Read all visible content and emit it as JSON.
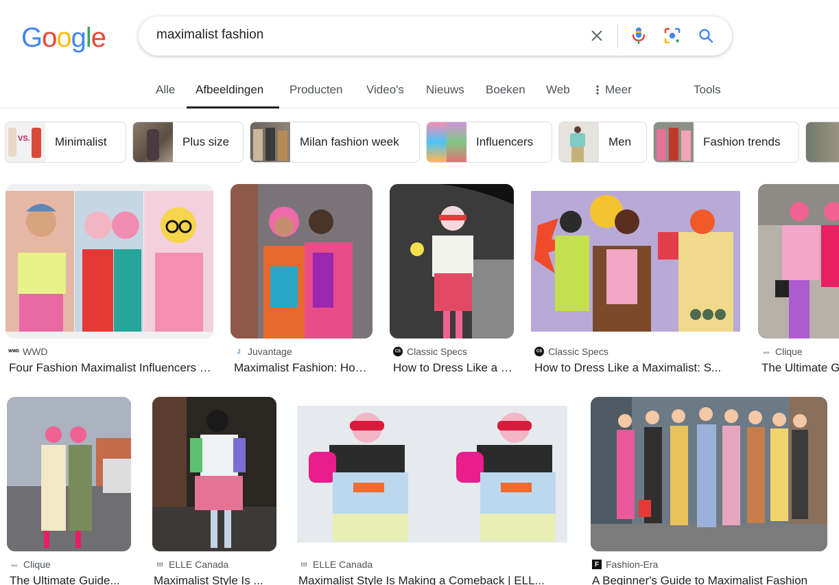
{
  "logo": {
    "letters": [
      "G",
      "o",
      "o",
      "g",
      "l",
      "e"
    ],
    "colors": [
      "#4285F4",
      "#EA4335",
      "#FBBC05",
      "#4285F4",
      "#34A853",
      "#EA4335"
    ]
  },
  "search": {
    "query": "maximalist fashion",
    "icons": [
      "close-icon",
      "microphone-icon",
      "lens-icon",
      "search-icon"
    ]
  },
  "tabs": {
    "items": [
      {
        "label": "Alle"
      },
      {
        "label": "Afbeeldingen"
      },
      {
        "label": "Producten"
      },
      {
        "label": "Video's"
      },
      {
        "label": "Nieuws"
      },
      {
        "label": "Boeken"
      },
      {
        "label": "Web"
      },
      {
        "label": "Meer"
      }
    ],
    "tools": "Tools",
    "active": "Afbeeldingen"
  },
  "chips": [
    {
      "label": "Minimalist",
      "thumb_text": "VS."
    },
    {
      "label": "Plus size"
    },
    {
      "label": "Milan fashion week"
    },
    {
      "label": "Influencers"
    },
    {
      "label": "Men"
    },
    {
      "label": "Fashion trends"
    }
  ],
  "results": [
    {
      "source": "WWD",
      "favicon": "WWD",
      "title": "Four Fashion Maximalist Influencers to ..."
    },
    {
      "source": "Juvantage",
      "favicon": "J",
      "title": "Maximalist Fashion: How to ..."
    },
    {
      "source": "Classic Specs",
      "favicon": "CS",
      "title": "How to Dress Like a Maximalist ..."
    },
    {
      "source": "Classic Specs",
      "favicon": "CS",
      "title": "How to Dress Like a Maximalist: S..."
    },
    {
      "source": "Clique",
      "favicon": "",
      "title": "The Ultimate Guide to ..."
    },
    {
      "source": "Clique",
      "favicon": "",
      "title": "The Ultimate Guide..."
    },
    {
      "source": "ELLE Canada",
      "favicon": "IIII",
      "title": "Maximalist Style Is ..."
    },
    {
      "source": "ELLE Canada",
      "favicon": "IIII",
      "title": "Maximalist Style Is Making a Comeback | ELL..."
    },
    {
      "source": "Fashion-Era",
      "favicon": "F",
      "title": "A Beginner's Guide to Maximalist Fashion"
    }
  ]
}
